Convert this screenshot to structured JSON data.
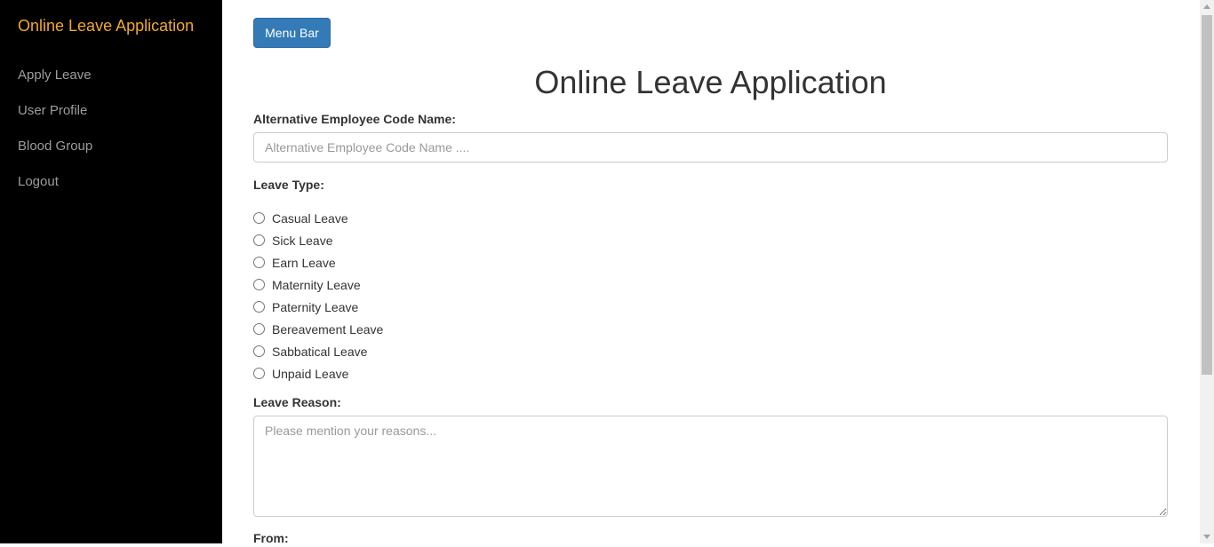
{
  "sidebar": {
    "brand": "Online Leave Application",
    "items": [
      {
        "label": "Apply Leave"
      },
      {
        "label": "User Profile"
      },
      {
        "label": "Blood Group"
      },
      {
        "label": "Logout"
      }
    ]
  },
  "main": {
    "menu_button_label": "Menu Bar",
    "title": "Online Leave Application",
    "employee_code": {
      "label": "Alternative Employee Code Name:",
      "placeholder": "Alternative Employee Code Name ....",
      "value": ""
    },
    "leave_type": {
      "label": "Leave Type:",
      "options": [
        {
          "label": "Casual Leave"
        },
        {
          "label": "Sick Leave"
        },
        {
          "label": "Earn Leave"
        },
        {
          "label": "Maternity Leave"
        },
        {
          "label": "Paternity Leave"
        },
        {
          "label": "Bereavement Leave"
        },
        {
          "label": "Sabbatical Leave"
        },
        {
          "label": "Unpaid Leave"
        }
      ]
    },
    "leave_reason": {
      "label": "Leave Reason:",
      "placeholder": "Please mention your reasons...",
      "value": ""
    },
    "from_label": "From:"
  },
  "colors": {
    "sidebar_bg": "#000000",
    "brand": "#f0a830",
    "nav_text": "#9d9d9d",
    "primary_button": "#337ab7"
  }
}
